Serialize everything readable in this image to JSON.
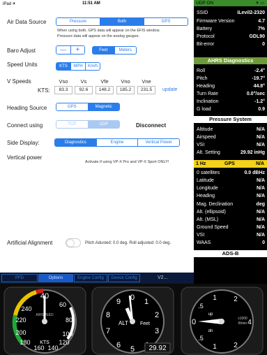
{
  "status": {
    "device": "iPad ✈",
    "time": "11:51 AM"
  },
  "air_data_source": {
    "label": "Air Data Source",
    "options": [
      "Pressure",
      "Both",
      "GPS"
    ],
    "selected": 1,
    "note_1": "When using both, GPS data will appear on the EFIS window.",
    "note_2": "Pressure data will appear on the analog gauges."
  },
  "baro_adjust": {
    "label": "Baro Adjust",
    "minus": "—",
    "plus": "+",
    "units": [
      "Feet",
      "Meters"
    ],
    "selected": 0
  },
  "speed_units": {
    "label": "Speed Units",
    "options": [
      "KTS",
      "MPH",
      "Km/h"
    ],
    "selected": 0
  },
  "v_speeds": {
    "label": "V Speeds",
    "unit_label": "KTS:",
    "columns": [
      "Vso",
      "Vs",
      "Vfe",
      "Vno",
      "Vne"
    ],
    "values": [
      "83.3",
      "92.6",
      "148.2",
      "185.2",
      "231.5"
    ],
    "update": "update"
  },
  "heading_source": {
    "label": "Heading Source",
    "options": [
      "GPS",
      "Magnetic"
    ],
    "selected": 1
  },
  "connect_using": {
    "label": "Connect using",
    "options": [
      "TCP",
      "UDP"
    ],
    "selected": 1,
    "action": "Disconnect"
  },
  "side_display": {
    "label": "Side Display:",
    "options": [
      "Diagnostics",
      "Engine",
      "Vertical Power"
    ],
    "selected": 0
  },
  "vertical_power": {
    "label": "Vertical power",
    "note": "Activate if using VP-X Pro and VP-X Sport ONLY!"
  },
  "artificial_alignment": {
    "label": "Artificial Alignment",
    "status": "Pitch Adusted: 0.0 deg. Roll adjusted: 0.0 deg."
  },
  "tabs": {
    "items": [
      "PFD",
      "Options",
      "Engine Config",
      "Device Config"
    ],
    "selected": 1,
    "version": "V2..."
  },
  "data_panel": {
    "udp": {
      "label": "UDP ON",
      "right": "✈ ▭"
    },
    "system": [
      {
        "k": "SSID",
        "v": "iLevil2-2320"
      },
      {
        "k": "Firmware Version",
        "v": "4.7"
      },
      {
        "k": "Battery",
        "v": "7%"
      },
      {
        "k": "Protocol",
        "v": "GDL90"
      },
      {
        "k": "Bit-error",
        "v": "0"
      }
    ],
    "ahrs_title": "AHRS Diagnostics",
    "ahrs": [
      {
        "k": "Roll",
        "v": "-2.4°"
      },
      {
        "k": "Pitch",
        "v": "-19.7°"
      },
      {
        "k": "Heading",
        "v": "44.8°"
      },
      {
        "k": "Turn Rate",
        "v": "0.0°/sec"
      },
      {
        "k": "Inclination",
        "v": "-1.2°"
      },
      {
        "k": "G load",
        "v": "0.9"
      }
    ],
    "pressure_title": "Pressure System",
    "pressure": [
      {
        "k": "Altitude",
        "v": "N/A"
      },
      {
        "k": "Airspeed",
        "v": "N/A"
      },
      {
        "k": "VSI",
        "v": "N/A"
      },
      {
        "k": "Alt. Setting",
        "v": "29.92 inHg"
      }
    ],
    "gps_bar": {
      "rate": "1 Hz",
      "title": "GPS",
      "value": "N/A"
    },
    "gps": [
      {
        "k": "0 satellites",
        "v": "0.0 dBHz"
      },
      {
        "k": "Latitude",
        "v": "N/A"
      },
      {
        "k": "Longitude",
        "v": "N/A"
      },
      {
        "k": "Heading",
        "v": "N/A"
      },
      {
        "k": "Mag. Declination",
        "v": "deg"
      },
      {
        "k": "Alt. (ellipsoid)",
        "v": "N/A"
      },
      {
        "k": "Alt. (MSL)",
        "v": "N/A"
      },
      {
        "k": "Ground Speed",
        "v": "N/A"
      },
      {
        "k": "VSI",
        "v": "N/A"
      },
      {
        "k": "WAAS",
        "v": "0"
      }
    ],
    "adsb_title": "ADS-B"
  },
  "gauges": {
    "airspeed": {
      "label_top": "AIRSPEED",
      "unit": "KTS",
      "ticks": [
        "40",
        "60",
        "80",
        "100",
        "120",
        "140",
        "160",
        "180",
        "200",
        "220",
        "240"
      ]
    },
    "altimeter": {
      "label": "ALT",
      "unit": "Feet",
      "digits": [
        "0",
        "1",
        "2",
        "3",
        "4",
        "5",
        "6",
        "7",
        "8",
        "9"
      ],
      "baro": "29.92"
    },
    "vsi": {
      "labels": [
        "0",
        ".5",
        "1",
        "2",
        "4",
        ".5",
        "1",
        "2"
      ],
      "up": "up",
      "dn": "dn",
      "unit_1": "x1000",
      "unit_2": "ft/min"
    }
  }
}
